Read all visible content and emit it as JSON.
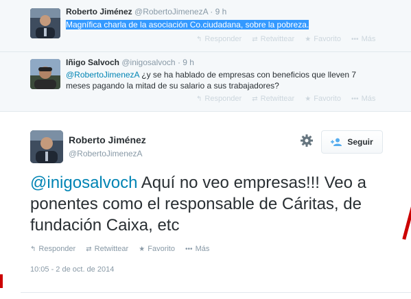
{
  "thread": [
    {
      "fullname": "Roberto Jiménez",
      "handle": "@RobertoJimenezA",
      "separator": "·",
      "time": "9 h",
      "text_selected": "Magnífica charla de la asociación Co.ciudadana, sobre la pobreza.",
      "actions": {
        "reply": "Responder",
        "retweet": "Retwittear",
        "favorite": "Favorito",
        "more": "Más"
      }
    },
    {
      "fullname": "Iñigo Salvoch",
      "handle": "@inigosalvoch",
      "separator": "·",
      "time": "9 h",
      "mention": "@RobertoJimenezA",
      "text": " ¿y se ha hablado de empresas con beneficios que lleven 7 meses pagando la mitad de su salario a sus trabajadores?",
      "actions": {
        "reply": "Responder",
        "retweet": "Retwittear",
        "favorite": "Favorito",
        "more": "Más"
      }
    }
  ],
  "main": {
    "fullname": "Roberto Jiménez",
    "handle": "@RobertoJimenezA",
    "follow_label": "Seguir",
    "mention": "@inigosalvoch",
    "text": " Aquí no veo empresas!!! Veo a ponentes como el responsable de Cáritas, de fundación Caixa, etc",
    "actions": {
      "reply": "Responder",
      "retweet": "Retwittear",
      "favorite": "Favorito",
      "more": "Más"
    },
    "timestamp": "10:05 - 2 de oct. de 2014"
  },
  "icons": {
    "reply": "reply-arrow-icon",
    "retweet": "retweet-icon",
    "favorite": "star-icon",
    "more": "ellipsis-icon",
    "settings": "gear-icon",
    "follow": "add-user-icon"
  },
  "colors": {
    "link": "#0084b4",
    "selection": "#3399ff",
    "muted": "#8899a6",
    "thread_bg": "#f5f8fa"
  }
}
